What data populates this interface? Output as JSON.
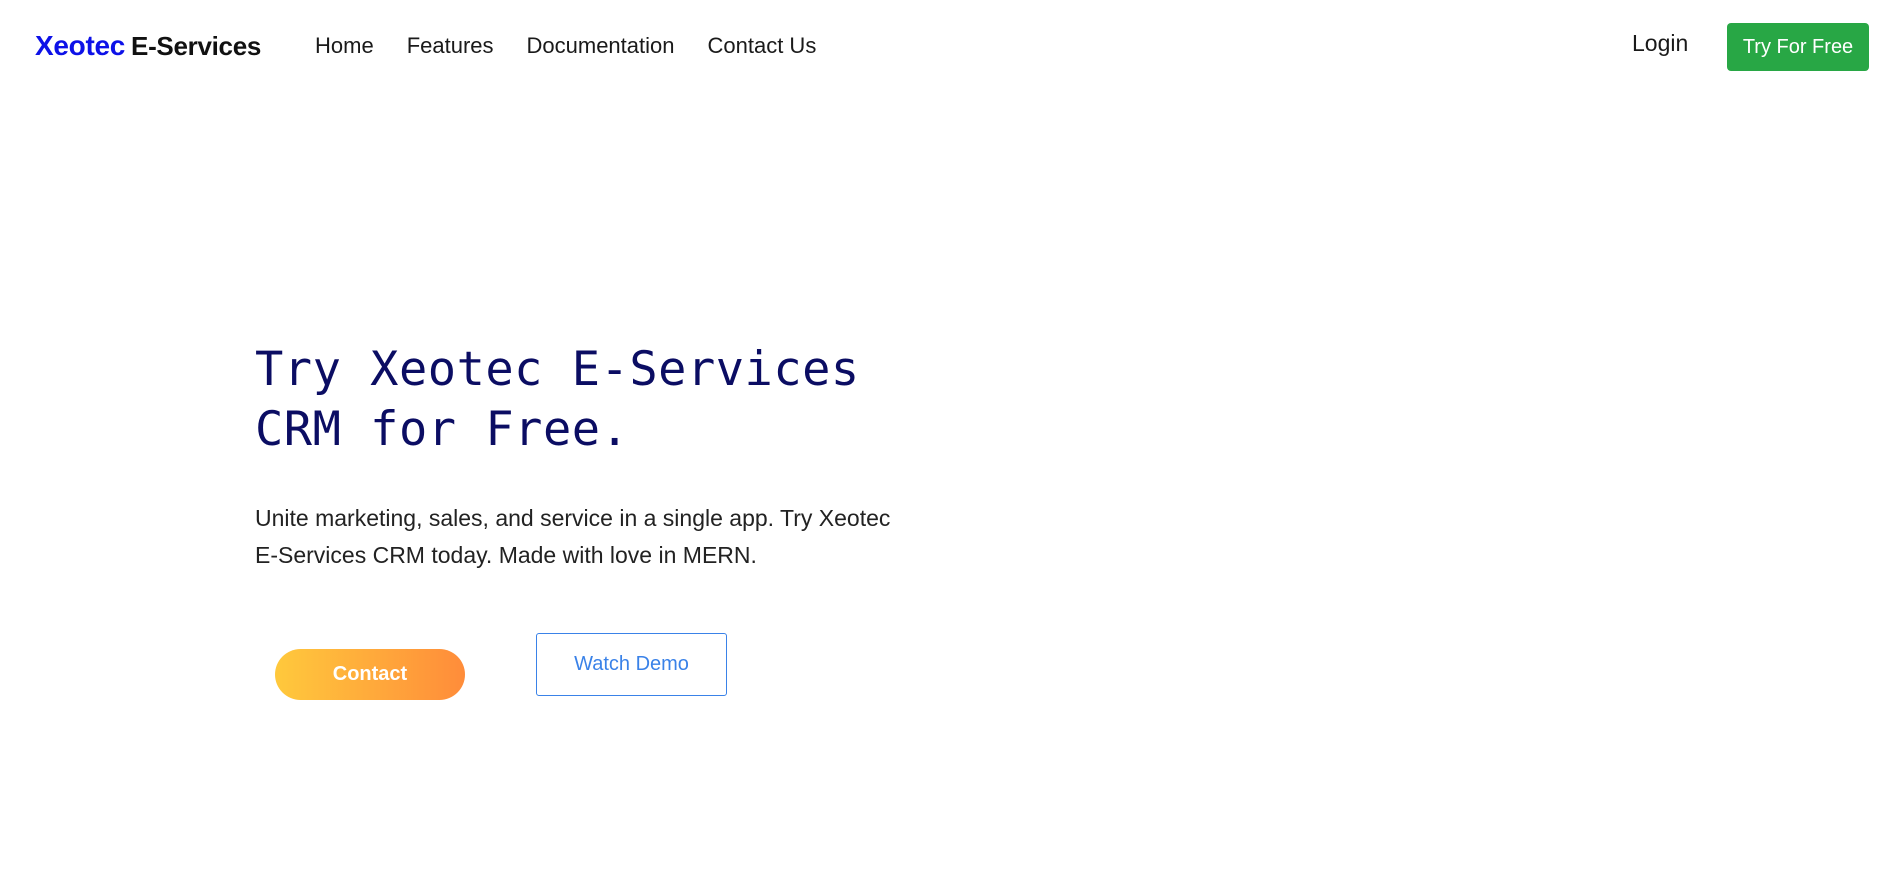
{
  "brand": {
    "primary": "Xeotec",
    "secondary": "E-Services"
  },
  "nav": {
    "items": [
      {
        "label": "Home"
      },
      {
        "label": "Features"
      },
      {
        "label": "Documentation"
      },
      {
        "label": "Contact Us"
      }
    ],
    "login_label": "Login",
    "cta_label": "Try For Free"
  },
  "hero": {
    "title_line1": "Try Xeotec E-Services",
    "title_line2": "CRM for Free.",
    "description_line1": "Unite marketing, sales, and service in a single app. Try Xeotec",
    "description_line2": "E-Services CRM today. Made with love in MERN.",
    "contact_label": "Contact",
    "demo_label": "Watch Demo"
  },
  "colors": {
    "brand_blue": "#0d11e8",
    "title_navy": "#0b0d63",
    "cta_green": "#28a745",
    "gradient_start": "#ffc93c",
    "gradient_end": "#ff8c3a",
    "demo_blue": "#3a82e8"
  }
}
